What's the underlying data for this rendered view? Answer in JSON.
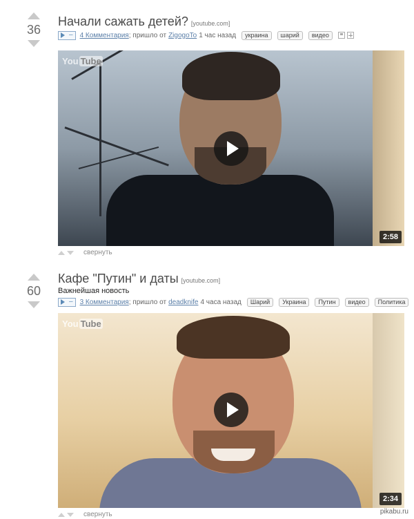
{
  "posts": [
    {
      "rating": "36",
      "title": "Начали сажать детей?",
      "source": "[youtube.com]",
      "subtitle": "",
      "comments": "4 Комментария",
      "from_text": "; пришло от",
      "author": "ZigogoTo",
      "time": "1 час назад",
      "tags": [
        "украина",
        "шарий",
        "видео"
      ],
      "duration": "2:58",
      "collapse": "свернуть"
    },
    {
      "rating": "60",
      "title": "Кафе \"Путин\" и даты",
      "source": "[youtube.com]",
      "subtitle": "Важнейшая новость",
      "comments": "3 Комментария",
      "from_text": "; пришло от",
      "author": "deadknife",
      "time": "4 часа назад",
      "tags": [
        "Шарий",
        "Украина",
        "Путин",
        "видео",
        "Политика"
      ],
      "duration": "2:34",
      "collapse": "свернуть"
    }
  ],
  "video_logo": "You",
  "video_logo_tube": "Tube",
  "watermark": "pikabu.ru",
  "icons": [
    "play-icon",
    "save-icon",
    "add-icon",
    "arrow-up-icon",
    "arrow-down-icon"
  ]
}
